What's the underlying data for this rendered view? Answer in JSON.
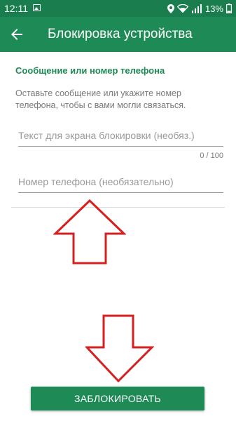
{
  "status_bar": {
    "time": "12:11",
    "battery_percent": "13%",
    "icons": [
      "gallery-icon",
      "location-icon",
      "wifi-icon",
      "signal-icon",
      "battery-icon"
    ]
  },
  "app_bar": {
    "title": "Блокировка устройства",
    "back_icon": "arrow-left-icon"
  },
  "section": {
    "heading": "Сообщение или номер телефона",
    "description": "Оставьте сообщение или укажите номер телефона, чтобы с вами могли связаться."
  },
  "lock_text_field": {
    "value": "",
    "placeholder": "Текст для экрана блокировки (необяз.)",
    "counter": "0 / 100"
  },
  "phone_field": {
    "value": "",
    "placeholder": "Номер телефона (необязательно)"
  },
  "actions": {
    "lock_button_label": "ЗАБЛОКИРОВАТЬ"
  },
  "colors": {
    "status_bar": "#1a7d4d",
    "app_bar": "#1e8a55",
    "accent": "#1e8a55",
    "annotation_arrow": "#d42020"
  }
}
